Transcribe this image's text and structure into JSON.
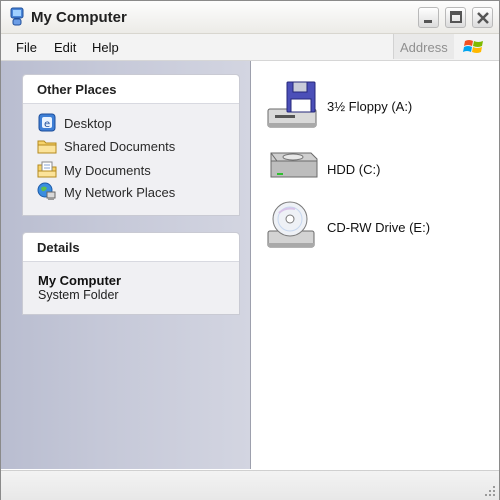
{
  "window": {
    "title": "My Computer",
    "controls": [
      "minimize-icon",
      "maximize-icon",
      "close-icon"
    ]
  },
  "menubar": {
    "items": [
      "File",
      "Edit",
      "Help"
    ],
    "address_label": "Address"
  },
  "sidebar": {
    "other_places": {
      "title": "Other Places",
      "items": [
        {
          "label": "Desktop",
          "icon": "desktop-icon"
        },
        {
          "label": "Shared Documents",
          "icon": "folder-icon"
        },
        {
          "label": "My Documents",
          "icon": "documents-icon"
        },
        {
          "label": "My Network Places",
          "icon": "network-icon"
        }
      ]
    },
    "details": {
      "title": "Details",
      "name": "My Computer",
      "type": "System Folder"
    }
  },
  "drives": [
    {
      "label": "3½ Floppy (A:)",
      "icon": "floppy-drive-icon"
    },
    {
      "label": "HDD (C:)",
      "icon": "hard-drive-icon"
    },
    {
      "label": "CD-RW Drive (E:)",
      "icon": "cd-drive-icon"
    }
  ],
  "colors": {
    "sidebar_bg": "#c5c8d8",
    "panel_bg": "#f0f0f3",
    "close_button": "#e8e8e8"
  }
}
